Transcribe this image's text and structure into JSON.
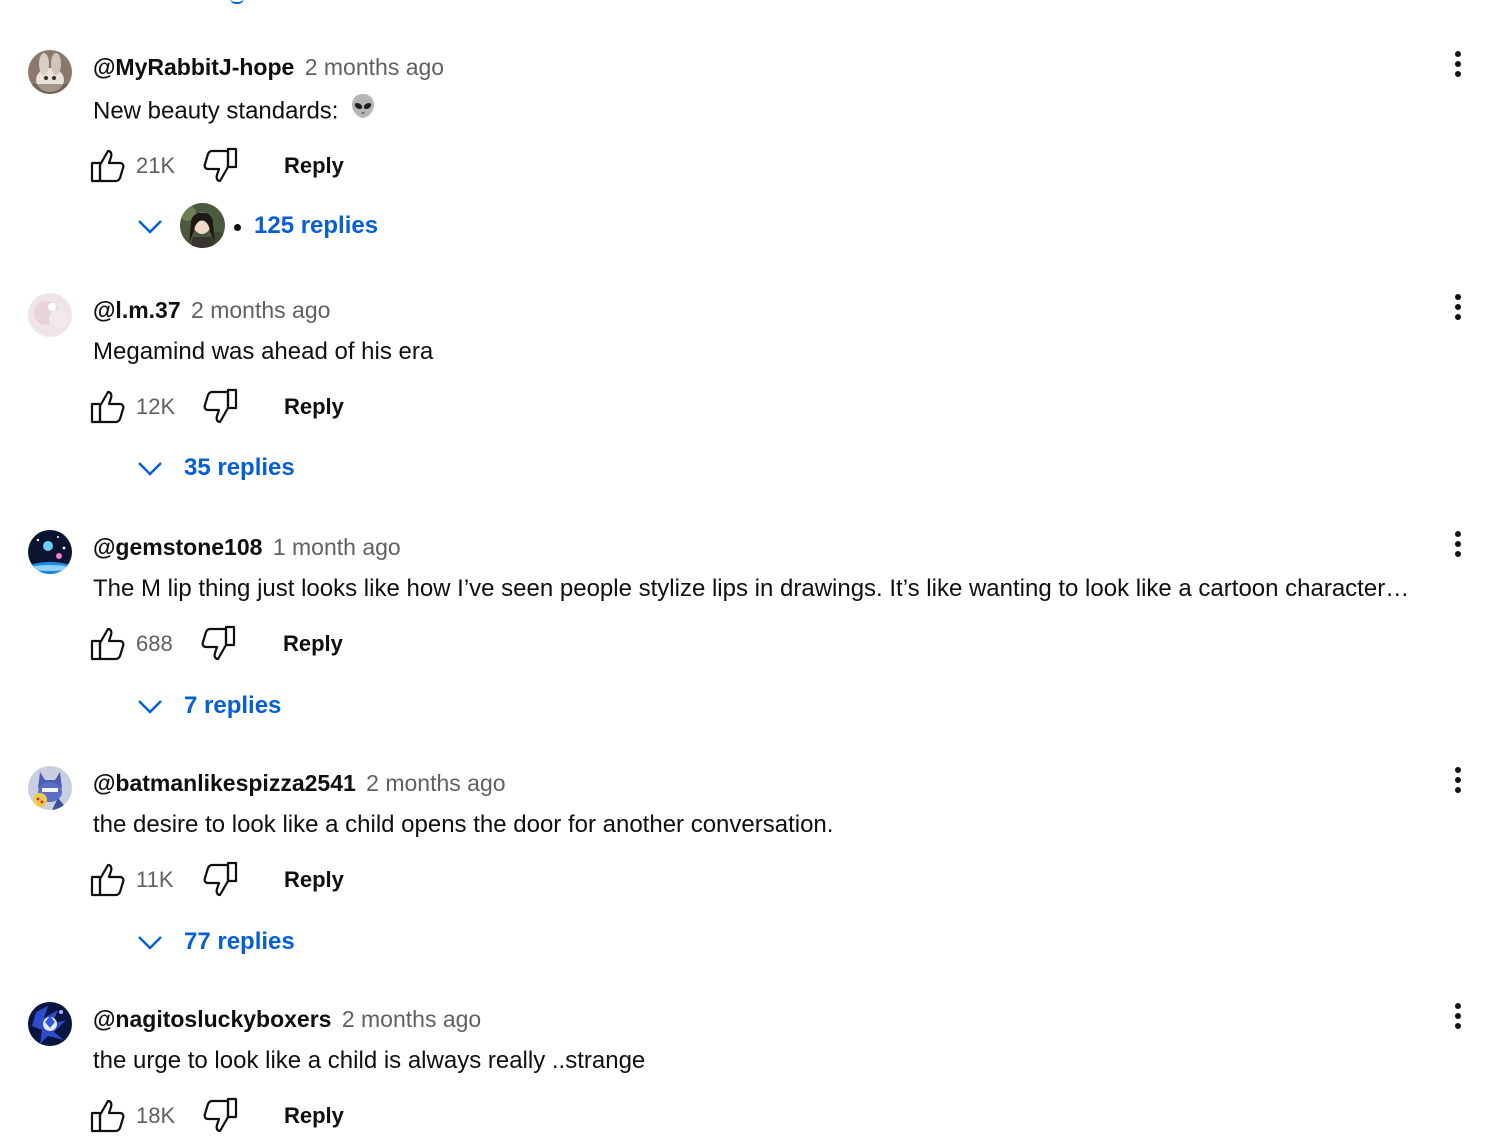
{
  "comments": [
    {
      "author": "@MyRabbitJ-hope",
      "time": "2 months ago",
      "text": "New beauty standards:",
      "emoji": "alien-emoji",
      "likes": "21K",
      "reply_label": "Reply",
      "replies_label": "125 replies",
      "has_creator_avatar": true
    },
    {
      "author": "@l.m.37",
      "time": "2 months ago",
      "text": "Megamind was ahead of his era",
      "likes": "12K",
      "reply_label": "Reply",
      "replies_label": "35 replies"
    },
    {
      "author": "@gemstone108",
      "time": "1 month ago",
      "text": "The M lip thing just looks like how I’ve seen people stylize lips in drawings. It’s like wanting to look like a cartoon character…",
      "likes": "688",
      "reply_label": "Reply",
      "replies_label": "7 replies"
    },
    {
      "author": "@batmanlikespizza2541",
      "time": "2 months ago",
      "text": "the desire to look like a child opens the door for another conversation.",
      "likes": "11K",
      "reply_label": "Reply",
      "replies_label": "77 replies"
    },
    {
      "author": "@nagitosluckyboxers",
      "time": "2 months ago",
      "text": "the urge to look like a child is always really ..strange",
      "likes": "18K",
      "reply_label": "Reply"
    }
  ],
  "colors": {
    "link_blue": "#065fd4",
    "text_primary": "#0f0f0f",
    "text_secondary": "#606060"
  },
  "icons": [
    "thumbs-up-icon",
    "thumbs-down-icon",
    "more-vert-icon",
    "chevron-down-icon",
    "alien-emoji"
  ]
}
